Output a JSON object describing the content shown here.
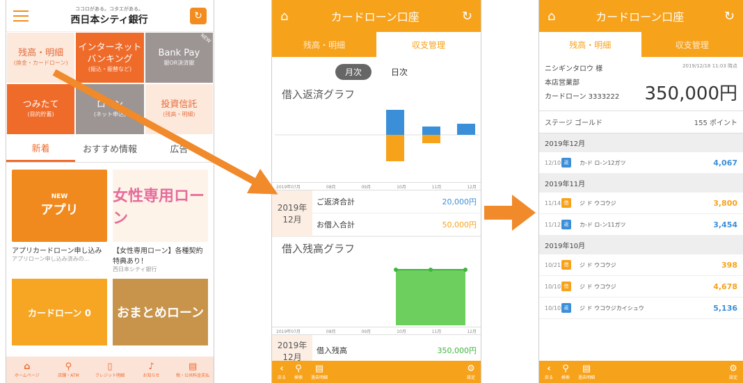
{
  "phone1": {
    "logo_tagline": "ココロがある。コタエがある。",
    "logo_name": "西日本シティ銀行",
    "tiles": [
      {
        "label": "残高・明細",
        "sub": "(換金・カードローン)"
      },
      {
        "label": "インターネット\nバンキング",
        "sub": "(振込・振替など)"
      },
      {
        "label": "Bank Pay",
        "sub": "銀OR決済銀"
      },
      {
        "label": "つみたて",
        "sub": "(目的貯蓄)"
      },
      {
        "label": "ローン",
        "sub": "(ネット申込)"
      },
      {
        "label": "投資信託",
        "sub": "(残高・明細)"
      }
    ],
    "new_badge": "NEW",
    "tabs": [
      "新着",
      "おすすめ情報",
      "広告"
    ],
    "news": [
      {
        "title": "アプリカードローン申し込み",
        "sub": "アプリローン申し込み済みの...",
        "img": "アプリ"
      },
      {
        "title": "【女性専用ローン】各種契約特典あり！",
        "sub": "西日本シティ銀行",
        "img": "女性専用ローン"
      },
      {
        "img": "カードローン 0"
      },
      {
        "img": "おまとめローン"
      }
    ],
    "bottom_nav": [
      "ホームページ",
      "店舗・ATM",
      "クレジット明細",
      "お知らせ",
      "税・公共料金支払"
    ]
  },
  "phone2": {
    "title": "カードローン口座",
    "subtabs": [
      "残高・明細",
      "収支管理"
    ],
    "toggle": [
      "月次",
      "日次"
    ],
    "graph1_title": "借入返済グラフ",
    "graph2_title": "借入残高グラフ",
    "axis": [
      "2019年07月",
      "08月",
      "09月",
      "10月",
      "11月",
      "12月"
    ],
    "summary_ym": "2019年\n12月",
    "repay_label": "ご返済合計",
    "repay_value": "20,000円",
    "borrow_label": "お借入合計",
    "borrow_value": "50,000円",
    "balance_ym": "2019年\n12月",
    "balance_label": "借入残高",
    "balance_value": "350,000円",
    "bottom_nav": [
      "戻る",
      "検索",
      "過去明細",
      "設定"
    ]
  },
  "phone3": {
    "title": "カードローン口座",
    "subtabs": [
      "残高・明細",
      "収支管理"
    ],
    "name": "ニシギンタロウ 様",
    "timestamp": "2019/12/18 11:03 時点",
    "branch": "本店営業部",
    "account": "カードローン 3333222",
    "balance": "350,000円",
    "stage_label": "ステージ ゴールド",
    "points": "155 ポイント",
    "months": [
      {
        "label": "2019年12月",
        "tx": [
          {
            "date": "12/10",
            "kind": "返",
            "name": "カ-ド ロ-ン12ガツ",
            "value": "4,067"
          }
        ]
      },
      {
        "label": "2019年11月",
        "tx": [
          {
            "date": "11/14",
            "kind": "借",
            "name": "ジ ド ウコウジ",
            "value": "3,800"
          },
          {
            "date": "11/12",
            "kind": "返",
            "name": "カ-ド ロ-ン11ガツ",
            "value": "3,454"
          }
        ]
      },
      {
        "label": "2019年10月",
        "tx": [
          {
            "date": "10/21",
            "kind": "借",
            "name": "ジ ド ウコウジ",
            "value": "398"
          },
          {
            "date": "10/10",
            "kind": "借",
            "name": "ジ ド ウコウジ",
            "value": "4,678"
          },
          {
            "date": "10/10",
            "kind": "返",
            "name": "ジ ド ウコウジカイシュウ",
            "value": "5,136"
          }
        ]
      }
    ],
    "bottom_nav": [
      "戻る",
      "検索",
      "過去明細",
      "設定"
    ]
  }
}
